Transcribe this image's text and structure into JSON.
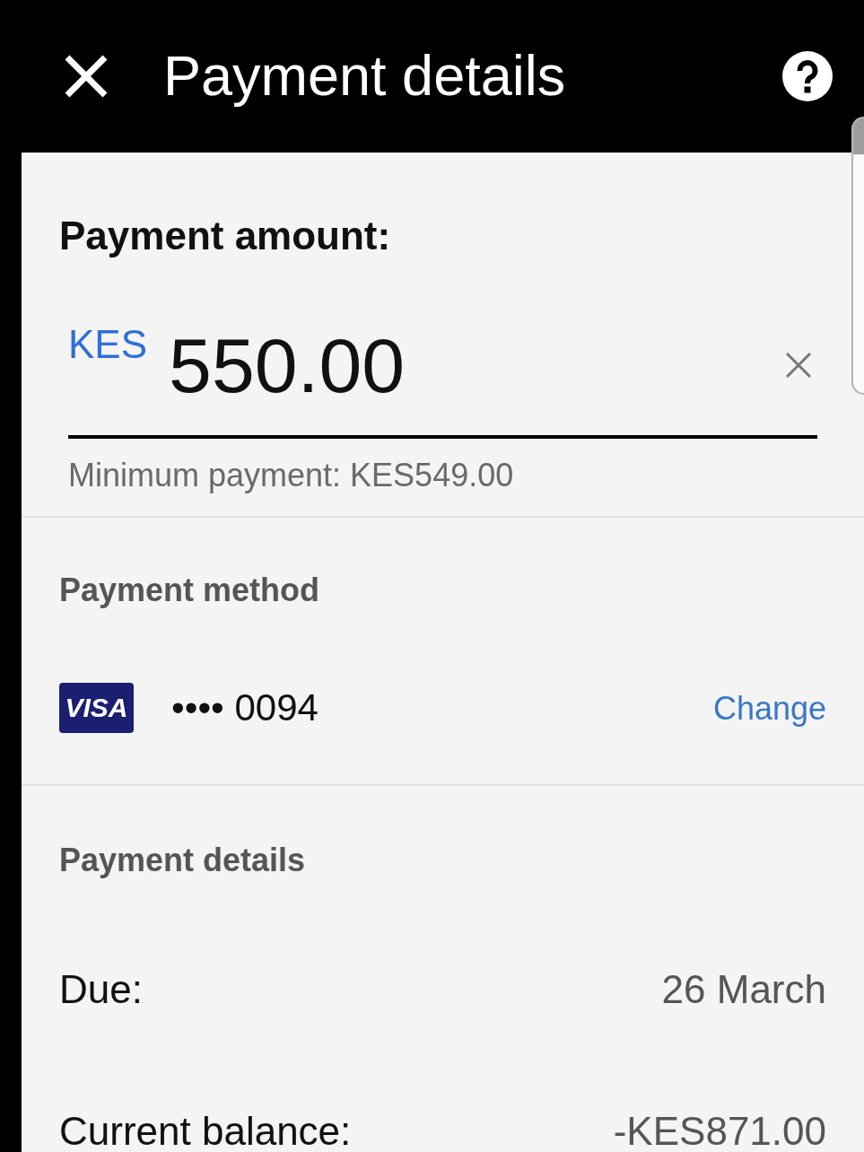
{
  "header": {
    "title": "Payment details"
  },
  "amount": {
    "label": "Payment amount:",
    "currency": "KES",
    "value": "550.00",
    "hint": "Minimum payment: KES549.00"
  },
  "payment_method": {
    "heading": "Payment method",
    "card": {
      "brand": "VISA",
      "number": "•••• 0094"
    },
    "action": "Change"
  },
  "payment_details": {
    "heading": "Payment details",
    "rows": [
      {
        "label": "Due:",
        "value": "26 March"
      },
      {
        "label": "Current balance:",
        "value": "-KES871.00"
      }
    ]
  }
}
